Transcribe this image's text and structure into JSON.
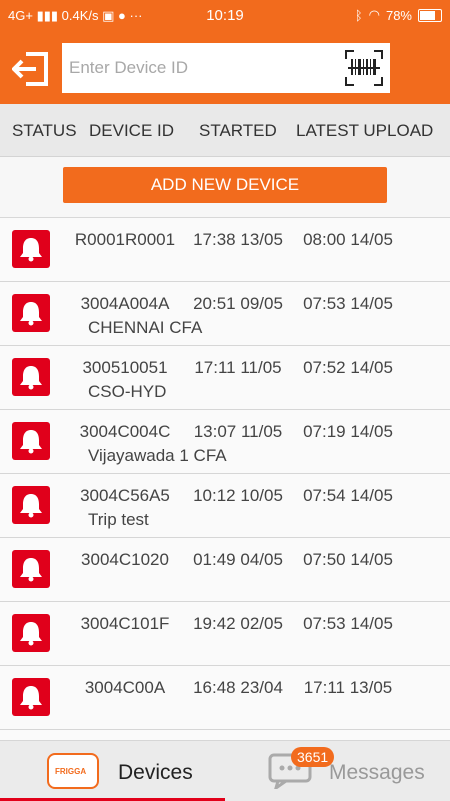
{
  "status_bar": {
    "network": "4G+",
    "speed": "0.4K/s",
    "time": "10:19",
    "battery": "78%"
  },
  "header": {
    "exit_icon": "exit-icon",
    "search": {
      "placeholder": "Enter Device ID",
      "value": ""
    },
    "scan_icon": "barcode-scan-icon"
  },
  "columns": [
    "STATUS",
    "DEVICE ID",
    "STARTED",
    "LATEST UPLOAD"
  ],
  "add_button_label": "ADD NEW DEVICE",
  "devices": [
    {
      "status_icon": "alarm-bell-icon",
      "id": "R0001R0001",
      "started": "17:38 13/05",
      "latest_upload": "08:00 14/05",
      "location": ""
    },
    {
      "status_icon": "alarm-bell-icon",
      "id": "3004A004A",
      "started": "20:51 09/05",
      "latest_upload": "07:53 14/05",
      "location": "CHENNAI CFA"
    },
    {
      "status_icon": "alarm-bell-icon",
      "id": "300510051",
      "started": "17:11 11/05",
      "latest_upload": "07:52 14/05",
      "location": "CSO-HYD"
    },
    {
      "status_icon": "alarm-bell-icon",
      "id": "3004C004C",
      "started": "13:07 11/05",
      "latest_upload": "07:19 14/05",
      "location": "Vijayawada 1 CFA"
    },
    {
      "status_icon": "alarm-bell-icon",
      "id": "3004C56A5",
      "started": "10:12 10/05",
      "latest_upload": "07:54 14/05",
      "location": "Trip test"
    },
    {
      "status_icon": "alarm-bell-icon",
      "id": "3004C1020",
      "started": "01:49 04/05",
      "latest_upload": "07:50 14/05",
      "location": ""
    },
    {
      "status_icon": "alarm-bell-icon",
      "id": "3004C101F",
      "started": "19:42 02/05",
      "latest_upload": "07:53 14/05",
      "location": ""
    },
    {
      "status_icon": "alarm-bell-icon",
      "id": "3004C00A",
      "started": "16:48 23/04",
      "latest_upload": "17:11 13/05",
      "location": ""
    }
  ],
  "tabs": {
    "devices": {
      "label": "Devices",
      "logo_text": "FRIGGA",
      "active": true
    },
    "messages": {
      "label": "Messages",
      "badge": "3651",
      "active": false
    }
  },
  "colors": {
    "accent": "#f26b1d",
    "alarm": "#e0001b",
    "active_tab_underline": "#e2001a"
  }
}
